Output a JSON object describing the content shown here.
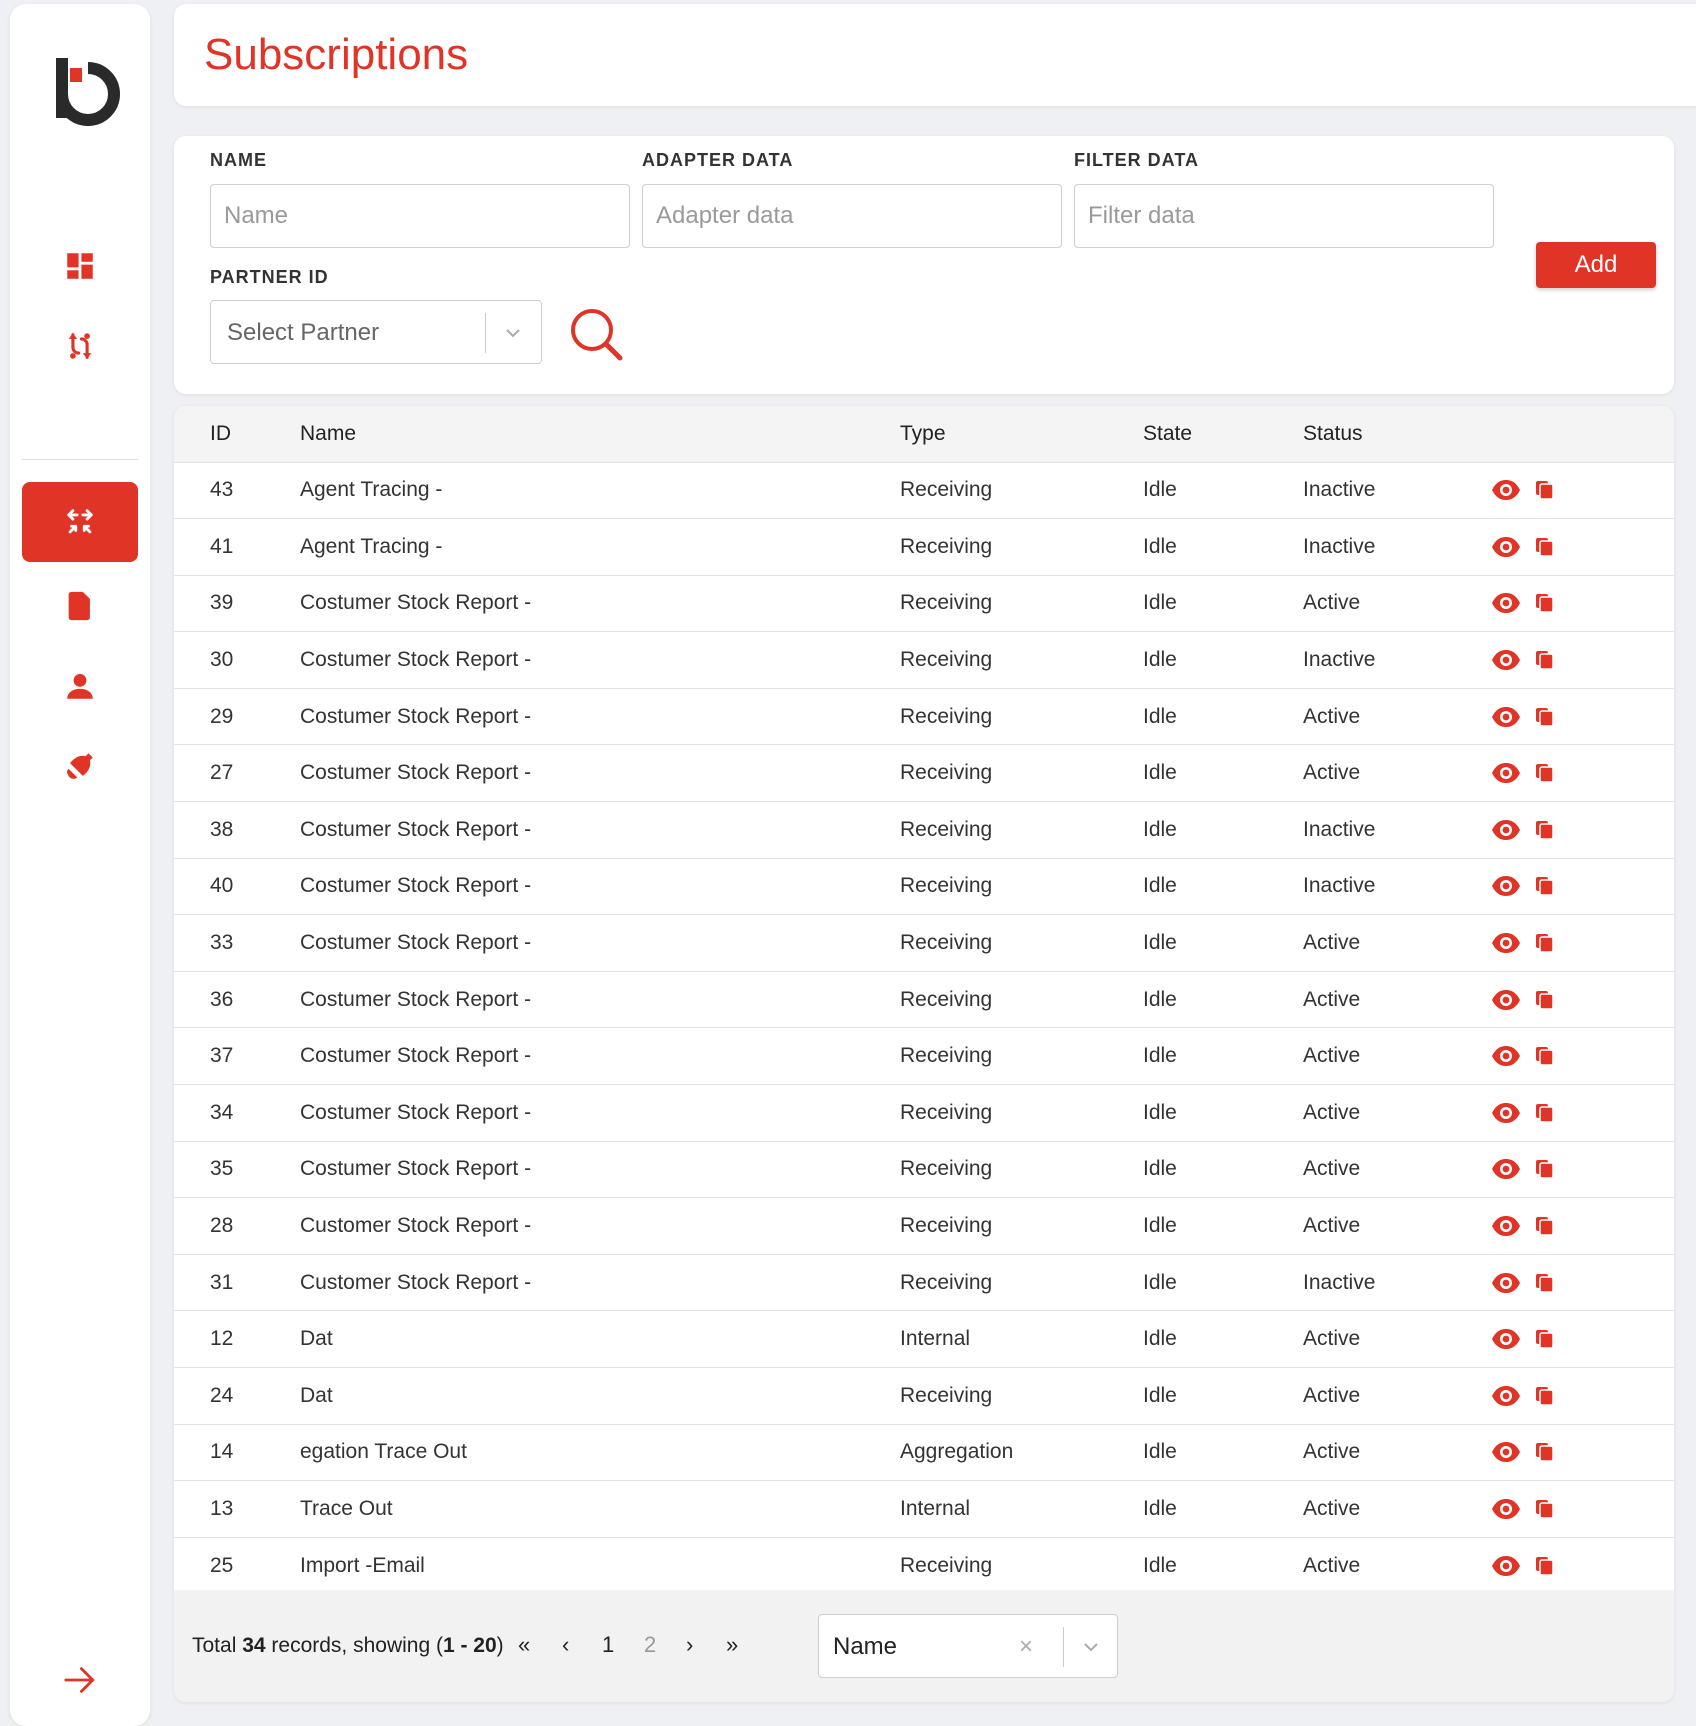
{
  "header": {
    "title": "Subscriptions"
  },
  "sidebar": {
    "logo": "b-logo",
    "items": [
      {
        "icon": "dashboard-icon",
        "active": false
      },
      {
        "icon": "sync-icon",
        "active": false
      },
      {
        "icon": "subscriptions-icon",
        "active": true
      },
      {
        "icon": "document-icon",
        "active": false
      },
      {
        "icon": "user-icon",
        "active": false
      },
      {
        "icon": "bell-icon",
        "active": false
      }
    ],
    "logout_icon": "arrow-right-icon"
  },
  "filters": {
    "name_label": "NAME",
    "name_placeholder": "Name",
    "adapter_label": "ADAPTER DATA",
    "adapter_placeholder": "Adapter data",
    "filter_label": "FILTER DATA",
    "filter_placeholder": "Filter data",
    "partner_label": "PARTNER ID",
    "partner_placeholder": "Select Partner",
    "add_label": "Add"
  },
  "table": {
    "columns": [
      "ID",
      "Name",
      "Type",
      "State",
      "Status"
    ],
    "rows": [
      {
        "id": "43",
        "name": "Agent Tracing -",
        "type": "Receiving",
        "state": "Idle",
        "status": "Inactive"
      },
      {
        "id": "41",
        "name": "Agent Tracing -",
        "type": "Receiving",
        "state": "Idle",
        "status": "Inactive"
      },
      {
        "id": "39",
        "name": "Costumer Stock Report -",
        "type": "Receiving",
        "state": "Idle",
        "status": "Active"
      },
      {
        "id": "30",
        "name": "Costumer Stock Report -",
        "type": "Receiving",
        "state": "Idle",
        "status": "Inactive"
      },
      {
        "id": "29",
        "name": "Costumer Stock Report -",
        "type": "Receiving",
        "state": "Idle",
        "status": "Active"
      },
      {
        "id": "27",
        "name": "Costumer Stock Report -",
        "type": "Receiving",
        "state": "Idle",
        "status": "Active"
      },
      {
        "id": "38",
        "name": "Costumer Stock Report -",
        "type": "Receiving",
        "state": "Idle",
        "status": "Inactive"
      },
      {
        "id": "40",
        "name": "Costumer Stock Report -",
        "type": "Receiving",
        "state": "Idle",
        "status": "Inactive"
      },
      {
        "id": "33",
        "name": "Costumer Stock Report -",
        "type": "Receiving",
        "state": "Idle",
        "status": "Active"
      },
      {
        "id": "36",
        "name": "Costumer Stock Report -",
        "type": "Receiving",
        "state": "Idle",
        "status": "Active"
      },
      {
        "id": "37",
        "name": "Costumer Stock Report -",
        "type": "Receiving",
        "state": "Idle",
        "status": "Active"
      },
      {
        "id": "34",
        "name": "Costumer Stock Report -",
        "type": "Receiving",
        "state": "Idle",
        "status": "Active"
      },
      {
        "id": "35",
        "name": "Costumer Stock Report -",
        "type": "Receiving",
        "state": "Idle",
        "status": "Active"
      },
      {
        "id": "28",
        "name": "Customer Stock Report -",
        "type": "Receiving",
        "state": "Idle",
        "status": "Active"
      },
      {
        "id": "31",
        "name": "Customer Stock Report -",
        "type": "Receiving",
        "state": "Idle",
        "status": "Inactive"
      },
      {
        "id": "12",
        "name": "Dat",
        "type": "Internal",
        "state": "Idle",
        "status": "Active"
      },
      {
        "id": "24",
        "name": "Dat",
        "type": "Receiving",
        "state": "Idle",
        "status": "Active"
      },
      {
        "id": "14",
        "name": "egation Trace Out",
        "type": "Aggregation",
        "state": "Idle",
        "status": "Active"
      },
      {
        "id": "13",
        "name": "Trace Out",
        "type": "Internal",
        "state": "Idle",
        "status": "Active"
      },
      {
        "id": "25",
        "name": "Import -Email",
        "type": "Receiving",
        "state": "Idle",
        "status": "Active"
      }
    ]
  },
  "footer": {
    "total_prefix": "Total ",
    "total_count": "34",
    "total_mid": " records, showing (",
    "range": "1 - 20",
    "total_suffix": ")",
    "first": "«",
    "prev": "‹",
    "page1": "1",
    "page2": "2",
    "next": "›",
    "last": "»",
    "sort_value": "Name",
    "clear": "×"
  },
  "colors": {
    "accent": "#e03427",
    "row_border": "#e2e2e2",
    "header_bg": "#f4f4f4"
  }
}
